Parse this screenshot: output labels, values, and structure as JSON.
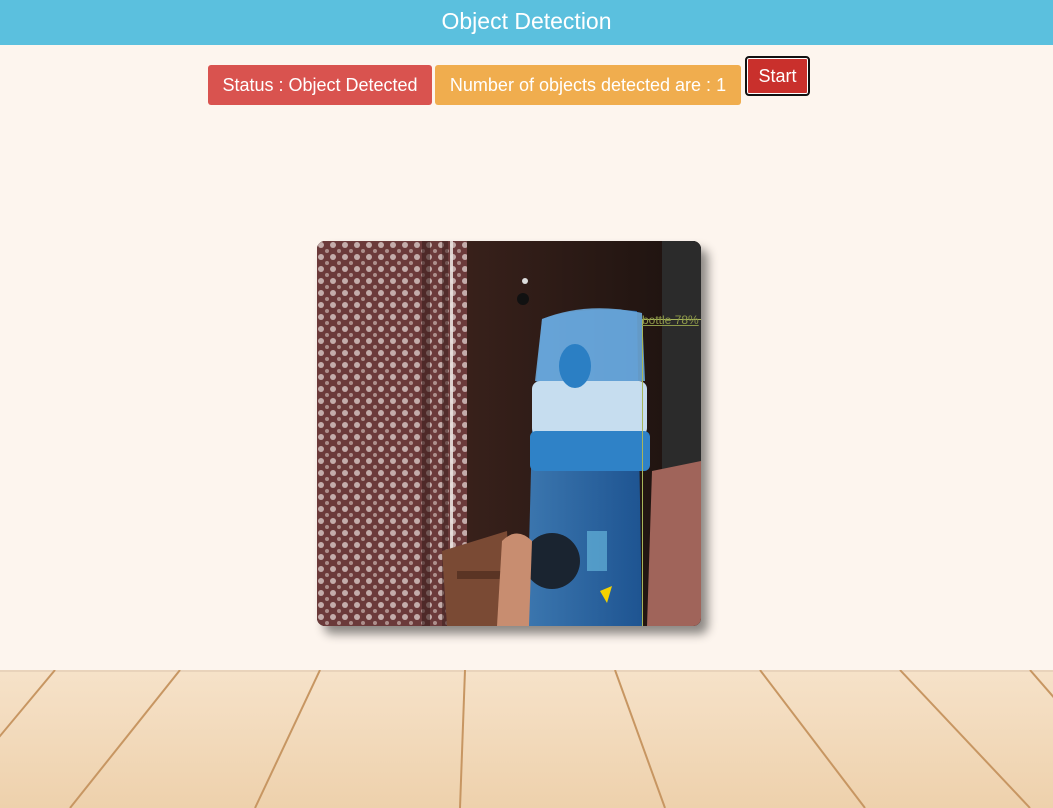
{
  "header": {
    "title": "Object Detection"
  },
  "status": {
    "status_text": "Status : Object Detected",
    "count_text": "Number of objects detected are : 1",
    "start_label": "Start"
  },
  "detection": {
    "label": "bottle 78%"
  },
  "colors": {
    "header_bg": "#5bc0de",
    "status_bg": "#d9534f",
    "count_bg": "#f0ad4e",
    "start_bg": "#c9302c",
    "page_bg": "#fdf5ee",
    "box_color": "#a8b65a"
  }
}
